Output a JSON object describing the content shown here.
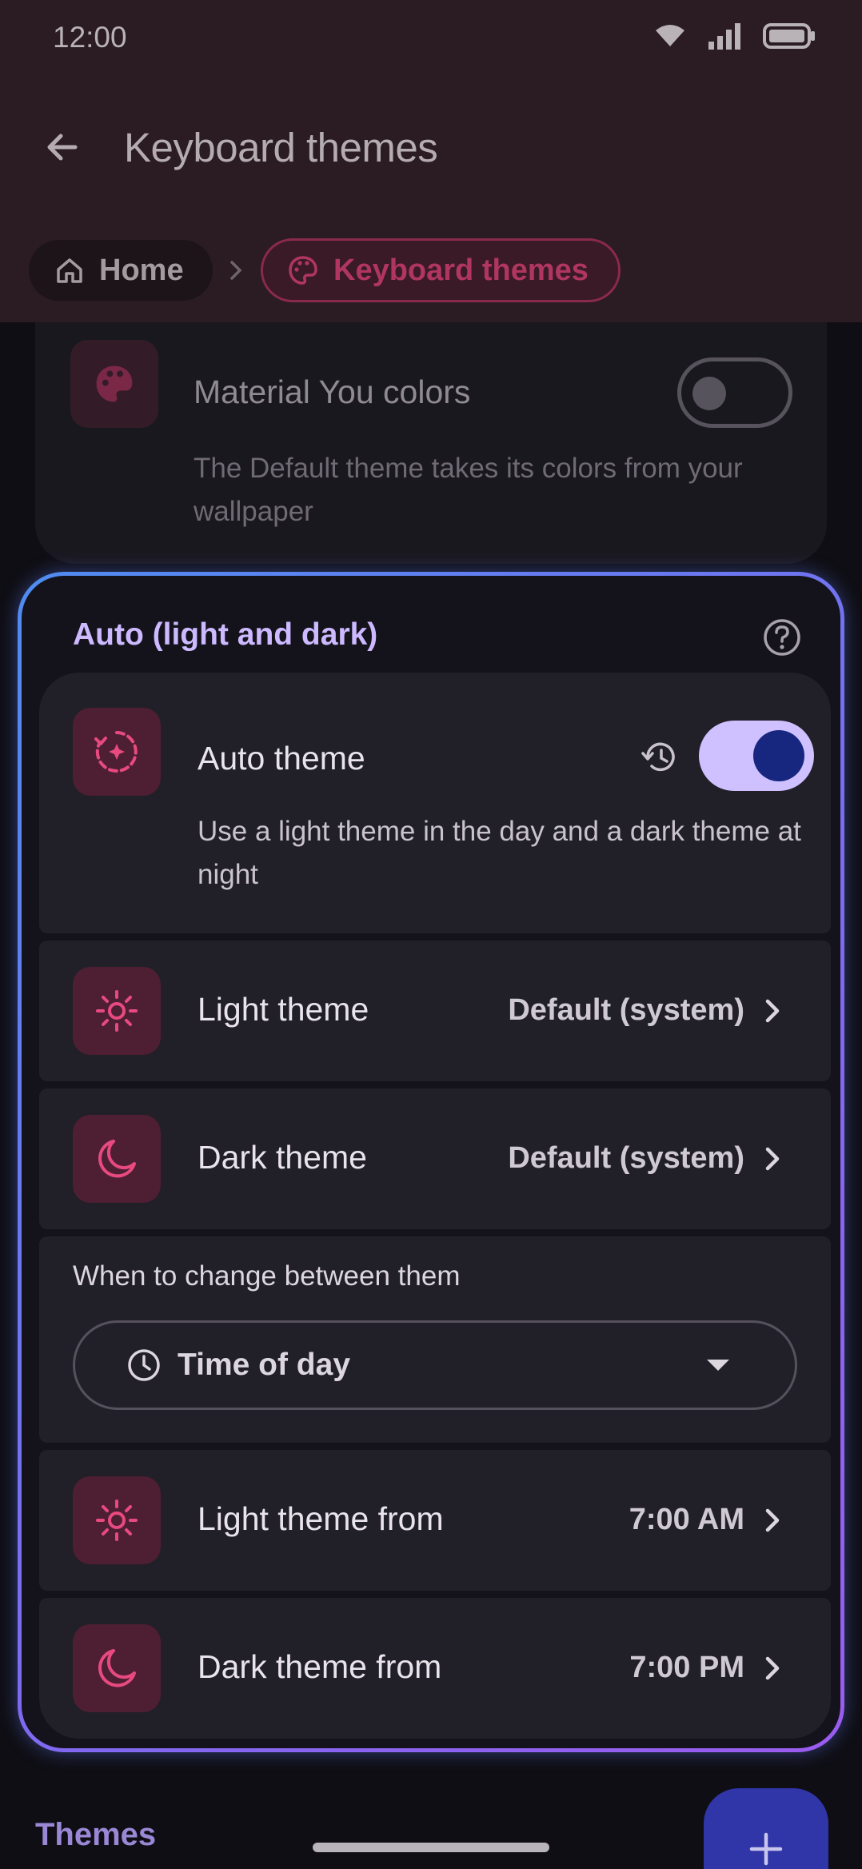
{
  "status": {
    "time": "12:00"
  },
  "appbar": {
    "title": "Keyboard themes"
  },
  "breadcrumb": {
    "home": "Home",
    "current": "Keyboard themes"
  },
  "material_you": {
    "title": "Material You colors",
    "subtitle": "The Default theme takes its colors from your wallpaper",
    "enabled": false
  },
  "auto_section": {
    "header": "Auto (light and dark)",
    "auto_theme": {
      "title": "Auto theme",
      "subtitle": "Use a light theme in the day and a dark theme at night",
      "enabled": true
    },
    "light_theme": {
      "label": "Light theme",
      "value": "Default (system)"
    },
    "dark_theme": {
      "label": "Dark theme",
      "value": "Default (system)"
    },
    "schedule": {
      "label": "When to change between them",
      "selected": "Time of day"
    },
    "light_from": {
      "label": "Light theme from",
      "value": "7:00 AM"
    },
    "dark_from": {
      "label": "Dark theme from",
      "value": "7:00 PM"
    }
  },
  "themes_section": {
    "label": "Themes"
  },
  "colors": {
    "accent_pink": "#e84a7f",
    "accent_purple": "#cdb9ff",
    "toggle_knob": "#17277f",
    "fab": "#3035a8"
  }
}
